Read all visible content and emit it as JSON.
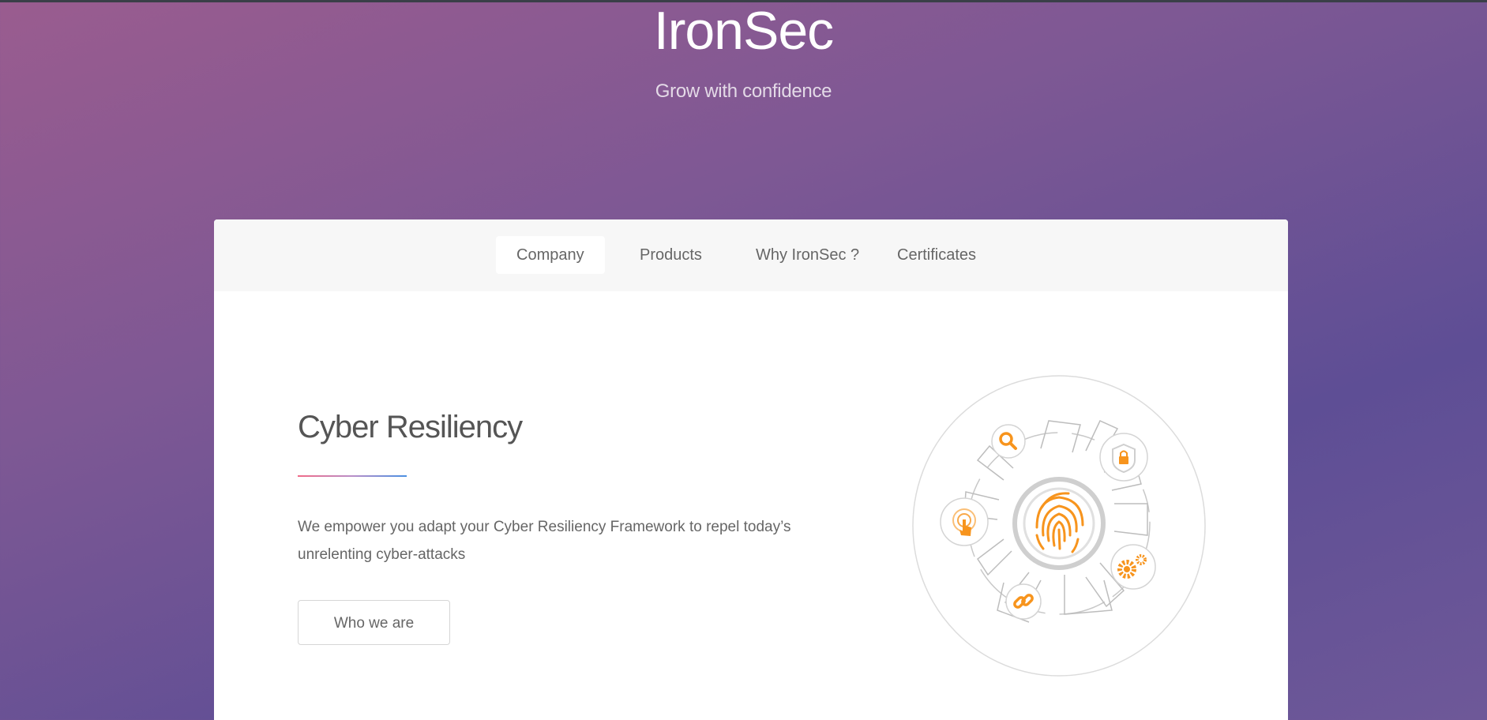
{
  "hero": {
    "title": "IronSec",
    "subtitle": "Grow with confidence"
  },
  "tabs": [
    {
      "label": "Company",
      "active": true
    },
    {
      "label": "Products",
      "active": false
    },
    {
      "label": "Why IronSec ?",
      "active": false
    },
    {
      "label": "Certificates",
      "active": false
    }
  ],
  "content": {
    "title": "Cyber Resiliency",
    "description": "We empower you adapt your Cyber Resiliency Framework to repel today’s unrelenting cyber-attacks",
    "button_label": "Who we are"
  },
  "illustration": {
    "center_icon": "fingerprint-icon",
    "orbit_icons": [
      "search-icon",
      "shield-lock-icon",
      "touch-icon",
      "gears-icon",
      "link-icon"
    ],
    "accent_color": "#f7941d"
  },
  "colors": {
    "background_gradient": [
      "#9a5c8f",
      "#5e4e95"
    ],
    "card": "#ffffff",
    "tabbar": "#f7f7f7",
    "divider_gradient": [
      "#f06b88",
      "#4a90e2"
    ]
  }
}
